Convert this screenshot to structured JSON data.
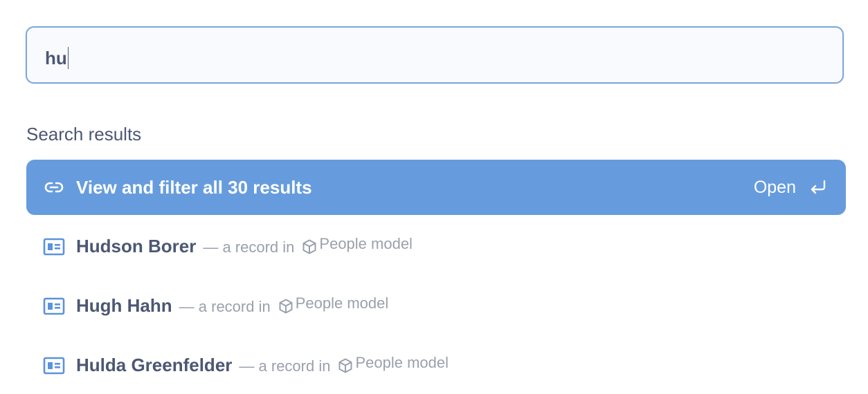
{
  "search": {
    "value": "hu"
  },
  "section_label": "Search results",
  "view_all": {
    "label": "View and filter all 30 results",
    "hint": "Open",
    "icon": "link-icon",
    "hint_icon": "enter-key-icon",
    "background": "#669cdd"
  },
  "results": [
    {
      "name": "Hudson Borer",
      "meta": "— a record in",
      "model": "People model",
      "icon": "record-card-icon",
      "model_icon": "model-cube-icon"
    },
    {
      "name": "Hugh Hahn",
      "meta": "— a record in",
      "model": "People model",
      "icon": "record-card-icon",
      "model_icon": "model-cube-icon"
    },
    {
      "name": "Hulda Greenfelder",
      "meta": "— a record in",
      "model": "People model",
      "icon": "record-card-icon",
      "model_icon": "model-cube-icon"
    }
  ],
  "colors": {
    "text_primary": "#4c5773",
    "text_muted": "#9aa0ac",
    "accent": "#669cdd",
    "icon_blue": "#5b93dc"
  }
}
